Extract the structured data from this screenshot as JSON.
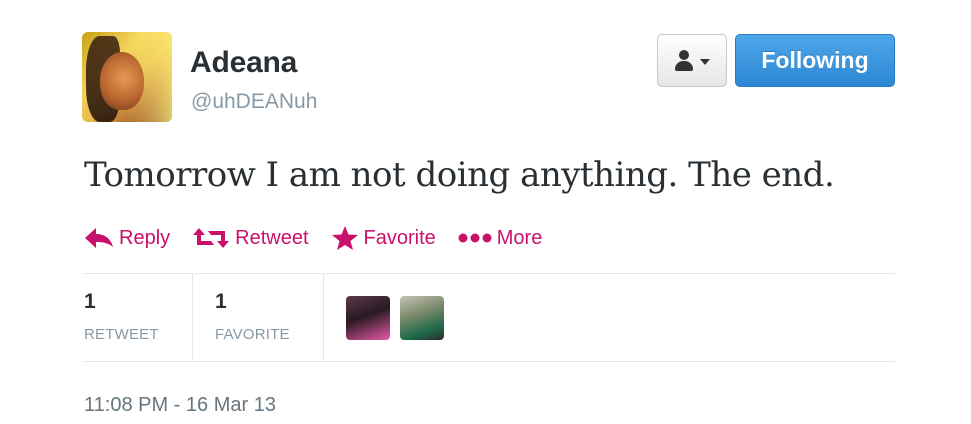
{
  "user": {
    "name": "Adeana",
    "handle": "@uhDEANuh"
  },
  "header_actions": {
    "user_dropdown_icon": "person-icon",
    "follow_label": "Following"
  },
  "tweet": {
    "text": "Tomorrow I am not doing anything. The end."
  },
  "actions": [
    {
      "label": "Reply",
      "icon": "reply-icon"
    },
    {
      "label": "Retweet",
      "icon": "retweet-icon"
    },
    {
      "label": "Favorite",
      "icon": "star-icon"
    },
    {
      "label": "More",
      "icon": "more-icon"
    }
  ],
  "stats": {
    "retweets": {
      "count": "1",
      "label": "RETWEET"
    },
    "favorites": {
      "count": "1",
      "label": "FAVORITE"
    }
  },
  "timestamp": "11:08 PM - 16 Mar 13",
  "colors": {
    "accent": "#c8116a",
    "follow_button": "#2c88d4",
    "muted": "#8899a6"
  }
}
